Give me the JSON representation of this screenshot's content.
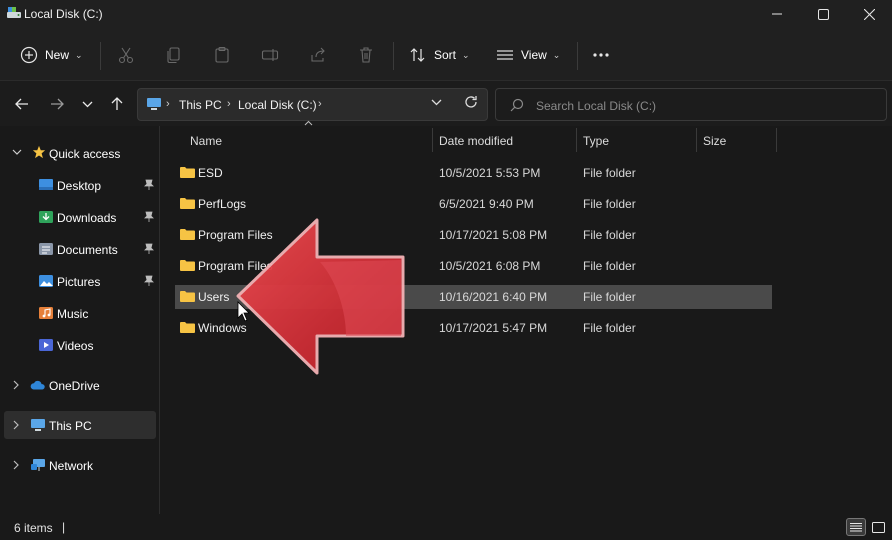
{
  "window": {
    "title": "Local Disk (C:)",
    "controls": [
      "minimize",
      "maximize",
      "close"
    ]
  },
  "toolbar": {
    "new_label": "New",
    "sort_label": "Sort",
    "view_label": "View",
    "icons": [
      "cut-icon",
      "copy-icon",
      "paste-icon",
      "rename-icon",
      "share-icon",
      "delete-icon",
      "more-icon"
    ]
  },
  "address": {
    "crumbs": [
      "This PC",
      "Local Disk (C:)"
    ]
  },
  "search": {
    "placeholder": "Search Local Disk (C:)"
  },
  "sidebar": {
    "quick_access": "Quick access",
    "items": [
      {
        "label": "Desktop",
        "pinned": true
      },
      {
        "label": "Downloads",
        "pinned": true
      },
      {
        "label": "Documents",
        "pinned": true
      },
      {
        "label": "Pictures",
        "pinned": true
      },
      {
        "label": "Music",
        "pinned": false
      },
      {
        "label": "Videos",
        "pinned": false
      }
    ],
    "onedrive": "OneDrive",
    "this_pc": "This PC",
    "network": "Network"
  },
  "columns": {
    "name": "Name",
    "date": "Date modified",
    "type": "Type",
    "size": "Size"
  },
  "files": [
    {
      "name": "ESD",
      "date": "10/5/2021 5:53 PM",
      "type": "File folder"
    },
    {
      "name": "PerfLogs",
      "date": "6/5/2021 9:40 PM",
      "type": "File folder"
    },
    {
      "name": "Program Files",
      "date": "10/17/2021 5:08 PM",
      "type": "File folder"
    },
    {
      "name": "Program Files",
      "date": "10/5/2021 6:08 PM",
      "type": "File folder"
    },
    {
      "name": "Users",
      "date": "10/16/2021 6:40 PM",
      "type": "File folder",
      "selected": true
    },
    {
      "name": "Windows",
      "date": "10/17/2021 5:47 PM",
      "type": "File folder"
    }
  ],
  "status": {
    "count": "6 items",
    "separator": "|"
  },
  "colors": {
    "folder": "#f6c344",
    "arrow": "#e0313a",
    "selection": "#4a4a4a"
  }
}
